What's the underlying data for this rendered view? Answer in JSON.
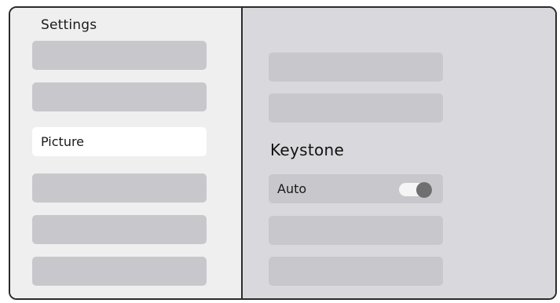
{
  "sidebar": {
    "title": "Settings",
    "items": [
      {
        "label": ""
      },
      {
        "label": ""
      },
      {
        "label": "Picture",
        "selected": true
      },
      {
        "label": ""
      },
      {
        "label": ""
      },
      {
        "label": ""
      }
    ]
  },
  "panel": {
    "heading": "Keystone",
    "options_above": [
      {
        "label": ""
      },
      {
        "label": ""
      }
    ],
    "auto": {
      "label": "Auto",
      "toggle_on": true
    },
    "options_below": [
      {
        "label": ""
      },
      {
        "label": ""
      }
    ]
  },
  "colors": {
    "sidebar_bg": "#efefef",
    "panel_bg": "#d9d8dc",
    "item_bg": "#c8c7cb",
    "selected_bg": "#ffffff",
    "toggle_knob": "#6f6f72"
  }
}
